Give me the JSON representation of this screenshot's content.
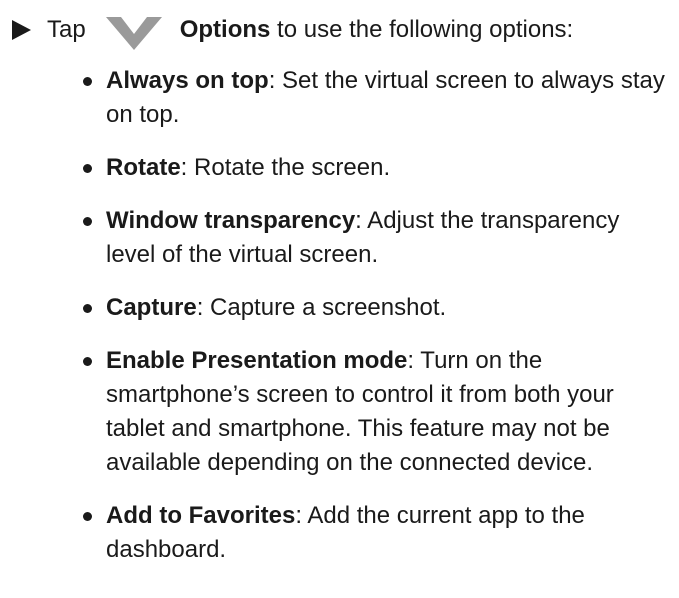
{
  "intro": {
    "prefix": "Tap",
    "icon": "chevron-down-icon",
    "icon_color": "#9a9a9a",
    "options_label": "Options",
    "suffix": "to use the following options:"
  },
  "options": [
    {
      "term": "Always on top",
      "desc": ": Set the virtual screen to always stay on top."
    },
    {
      "term": "Rotate",
      "desc": ": Rotate the screen."
    },
    {
      "term": "Window transparency",
      "desc": ": Adjust the transparency level of the virtual screen."
    },
    {
      "term": "Capture",
      "desc": ": Capture a screenshot."
    },
    {
      "term": "Enable Presentation mode",
      "desc": ": Turn on the smartphone’s screen to control it from both your tablet and smartphone. This feature may not be available depending on the connected device."
    },
    {
      "term": "Add to Favorites",
      "desc": ": Add the current app to the dashboard."
    }
  ]
}
